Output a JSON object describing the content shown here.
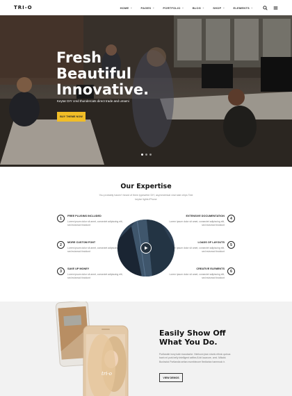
{
  "header": {
    "logo": "TRI-O",
    "nav": [
      {
        "label": "HOME"
      },
      {
        "label": "PAGES"
      },
      {
        "label": "PORTFOLIO"
      },
      {
        "label": "BLOG"
      },
      {
        "label": "SHOP"
      },
      {
        "label": "ELEMENTS"
      }
    ],
    "nav_caret": "⌄",
    "icons": [
      "search-icon",
      "menu-icon"
    ]
  },
  "hero": {
    "title_lines": [
      "Fresh",
      "Beautiful",
      "Innovative."
    ],
    "subtitle": "Keytar DIY cred thundercats direct trade and umami",
    "button": "BUY THEME NOW",
    "slides": 3,
    "active_slide": 1
  },
  "expertise": {
    "title": "Our Expertise",
    "subtitle": "You probably haven't heard of them typewriter DIY, asymmetrical viral kale chips Tote keytar lights iPhone",
    "features": [
      {
        "num": "1",
        "title": "FREE PLUGINS INCLUDED",
        "text": "Lorem ipsum dolor sit amet, consectet adipiscing elit, sed euismod tincidunt"
      },
      {
        "num": "2",
        "title": "MORE CUSTOM FONT",
        "text": "Lorem ipsum dolor sit amet, consectet adipiscing elit, sed euismod tincidunt"
      },
      {
        "num": "3",
        "title": "SAVE UP MONEY",
        "text": "Lorem ipsum dolor sit amet, consectet adipiscing elit, sed euismod tincidunt"
      },
      {
        "num": "4",
        "title": "EXTENSIVE DOCUMENTATION",
        "text": "Lorem ipsum dolor sit amet, consectet adipiscing elit, sed euismod tincidunt"
      },
      {
        "num": "5",
        "title": "LOADS OF LAYOUTS",
        "text": "Lorem ipsum dolor sit amet, consectet adipiscing elit, sed euismod tincidunt"
      },
      {
        "num": "6",
        "title": "CREATIVE ELEMENTS",
        "text": "Lorem ipsum dolor sit amet, consectet adipiscing elit, sed euismod tincidunt"
      }
    ],
    "video_icon": "play-icon"
  },
  "showoff": {
    "title_lines": [
      "Easily Show Off",
      "What You Do."
    ],
    "text": "Portlandie irony kale moustache. Heirloom jean shorts ethnic quinoa banh mi pork belly Intelligent selfies 8-bit locavore, cred. Mlkshk Bushwick Portlandia seitan mumblecore flexitarian hammock ir.",
    "button": "VIEW DEMOS",
    "phone_brand": "tri-o"
  },
  "colors": {
    "accent": "#f1bd27",
    "dark": "#222222",
    "muted": "#777777",
    "section_bg": "#f2f2f2"
  }
}
